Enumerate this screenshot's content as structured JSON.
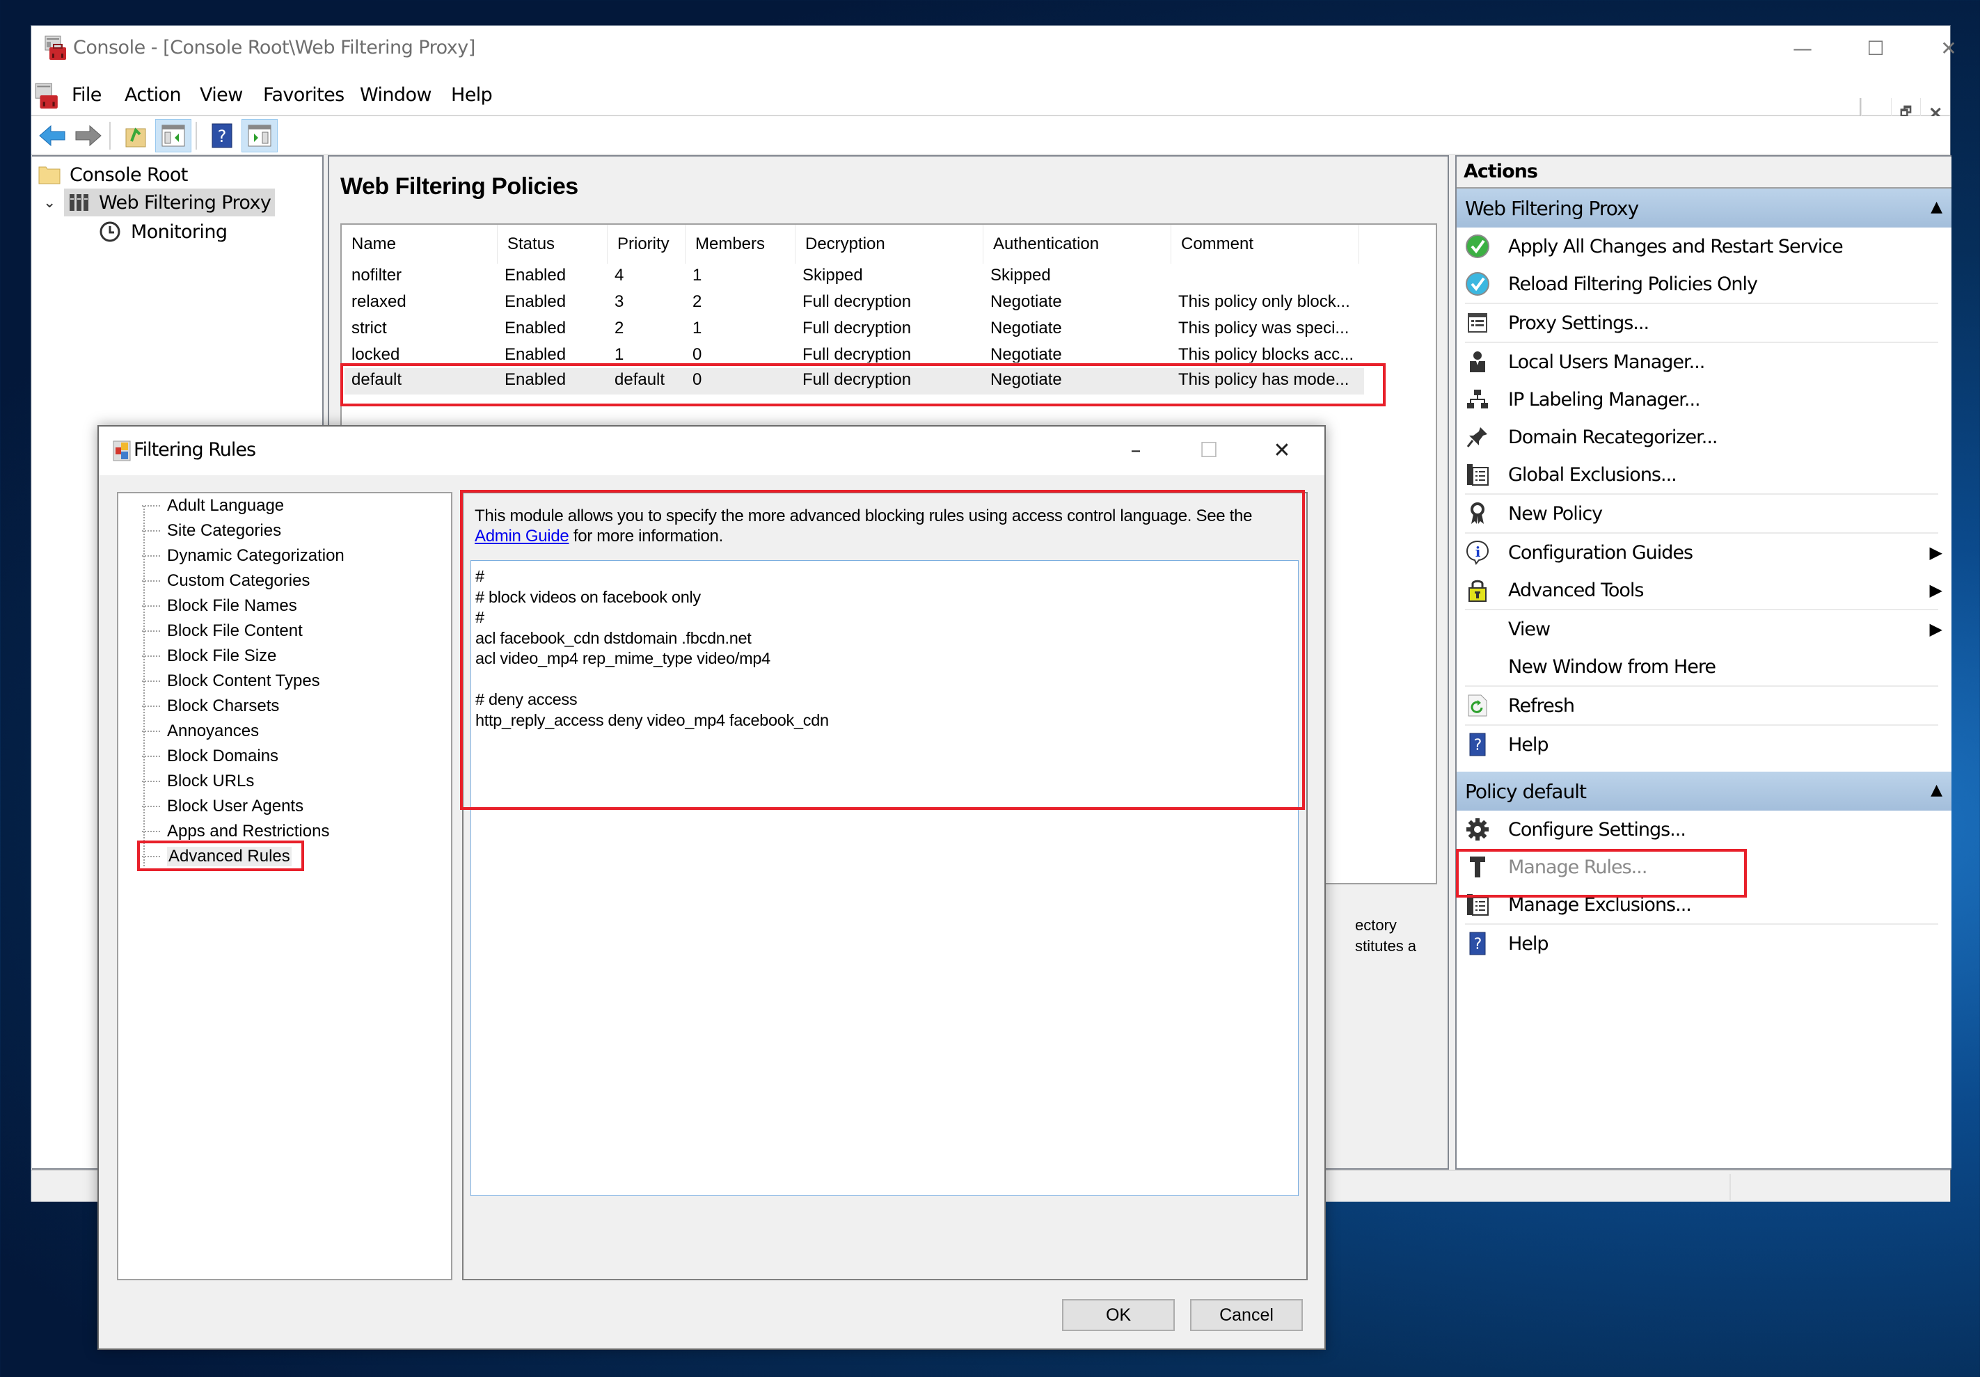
{
  "main_window": {
    "title": "Console - [Console Root\\Web Filtering Proxy]",
    "controls": {
      "minimize": "—",
      "maximize": "☐",
      "close": "✕"
    },
    "menu": [
      "File",
      "Action",
      "View",
      "Favorites",
      "Window",
      "Help"
    ],
    "mdi_controls": {
      "minimize": "_",
      "restore": "🗗",
      "close": "✕"
    },
    "toolbar": [
      {
        "name": "back",
        "icon": "back-arrow-icon"
      },
      {
        "name": "forward",
        "icon": "forward-arrow-icon"
      },
      {
        "name": "up-one-level",
        "icon": "folder-up-icon"
      },
      {
        "name": "show-hide-console-tree",
        "icon": "console-tree-icon",
        "active": true
      },
      {
        "name": "help",
        "icon": "help-icon"
      },
      {
        "name": "show-hide-action-pane",
        "icon": "action-pane-icon",
        "active": true
      }
    ]
  },
  "tree": {
    "items": [
      {
        "label": "Console Root",
        "icon": "folder-icon",
        "level": 0
      },
      {
        "label": "Web Filtering Proxy",
        "icon": "library-icon",
        "level": 1,
        "expanded": true,
        "selected": true
      },
      {
        "label": "Monitoring",
        "icon": "clock-icon",
        "level": 2
      }
    ]
  },
  "center": {
    "title": "Web Filtering Policies",
    "columns": [
      "Name",
      "Status",
      "Priority",
      "Members",
      "Decryption",
      "Authentication",
      "Comment"
    ],
    "rows": [
      {
        "name": "nofilter",
        "status": "Enabled",
        "priority": "4",
        "members": "1",
        "decryption": "Skipped",
        "authentication": "Skipped",
        "comment": ""
      },
      {
        "name": "relaxed",
        "status": "Enabled",
        "priority": "3",
        "members": "2",
        "decryption": "Full decryption",
        "authentication": "Negotiate",
        "comment": "This policy only block..."
      },
      {
        "name": "strict",
        "status": "Enabled",
        "priority": "2",
        "members": "1",
        "decryption": "Full decryption",
        "authentication": "Negotiate",
        "comment": "This policy was speci..."
      },
      {
        "name": "locked",
        "status": "Enabled",
        "priority": "1",
        "members": "0",
        "decryption": "Full decryption",
        "authentication": "Negotiate",
        "comment": "This policy blocks acc..."
      },
      {
        "name": "default",
        "status": "Enabled",
        "priority": "default",
        "members": "0",
        "decryption": "Full decryption",
        "authentication": "Negotiate",
        "comment": "This policy has mode...",
        "selected": true
      }
    ],
    "partial_text": [
      "ectory",
      "stitutes a"
    ]
  },
  "actions": {
    "header": "Actions",
    "sections": [
      {
        "title": "Web Filtering Proxy",
        "items": [
          {
            "label": "Apply All Changes and Restart Service",
            "icon": "green-check-icon"
          },
          {
            "label": "Reload Filtering Policies Only",
            "icon": "blue-check-icon"
          },
          {
            "label": "Proxy Settings...",
            "icon": "settings-list-icon"
          },
          {
            "label": "Local Users Manager...",
            "icon": "user-icon"
          },
          {
            "label": "IP Labeling Manager...",
            "icon": "network-tree-icon"
          },
          {
            "label": "Domain Recategorizer...",
            "icon": "pin-icon"
          },
          {
            "label": "Global Exclusions...",
            "icon": "exclusions-icon"
          },
          {
            "label": "New Policy",
            "icon": "ribbon-icon"
          },
          {
            "label": "Configuration Guides",
            "icon": "info-icon",
            "submenu": true
          },
          {
            "label": "Advanced Tools",
            "icon": "lock-icon",
            "submenu": true
          },
          {
            "label": "View",
            "icon": "",
            "submenu": true
          },
          {
            "label": "New Window from Here",
            "icon": ""
          },
          {
            "label": "Refresh",
            "icon": "refresh-icon"
          },
          {
            "label": "Help",
            "icon": "help-icon"
          }
        ]
      },
      {
        "title": "Policy default",
        "items": [
          {
            "label": "Configure Settings...",
            "icon": "gear-icon"
          },
          {
            "label": "Manage Rules...",
            "icon": "hammer-icon",
            "disabled": true
          },
          {
            "label": "Manage Exclusions...",
            "icon": "exclusions-icon"
          },
          {
            "label": "Help",
            "icon": "help-icon"
          }
        ]
      }
    ]
  },
  "dialog": {
    "title": "Filtering Rules",
    "controls": {
      "minimize": "–",
      "maximize": "☐",
      "close": "✕"
    },
    "modules": [
      "Adult Language",
      "Site Categories",
      "Dynamic Categorization",
      "Custom Categories",
      "Block File Names",
      "Block File Content",
      "Block File Size",
      "Block Content Types",
      "Block Charsets",
      "Annoyances",
      "Block Domains",
      "Block URLs",
      "Block User Agents",
      "Apps and Restrictions",
      "Advanced Rules"
    ],
    "selected_module": "Advanced Rules",
    "description_before_link": "This module allows you to specify the more advanced blocking rules using access control language. See the ",
    "description_link": "Admin Guide",
    "description_after_link": " for more information.",
    "rules_text": "#\n# block videos on facebook only\n#\nacl facebook_cdn dstdomain .fbcdn.net\nacl video_mp4 rep_mime_type video/mp4\n\n# deny access\nhttp_reply_access deny video_mp4 facebook_cdn\n\n",
    "ok_label": "OK",
    "cancel_label": "Cancel"
  },
  "colors": {
    "highlight_red": "#e8202a",
    "section_header_blue": "#b0c9e4",
    "link_blue": "#0000ee",
    "desktop_blue": "#0b4a8c"
  }
}
